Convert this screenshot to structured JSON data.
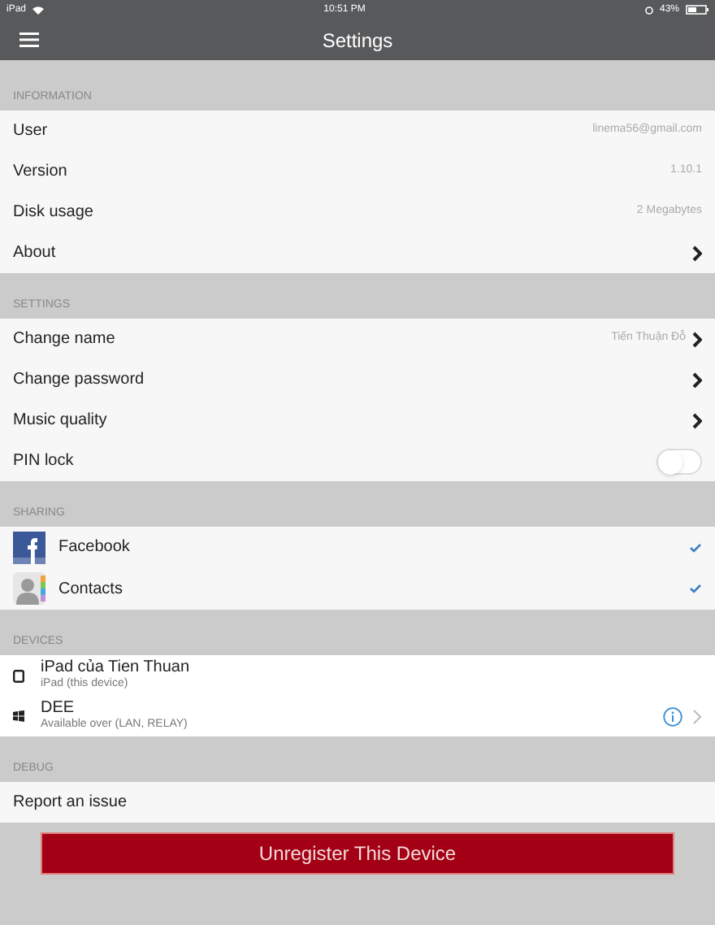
{
  "status_bar": {
    "carrier": "iPad",
    "time": "10:51 PM",
    "battery": "43%"
  },
  "nav": {
    "title": "Settings"
  },
  "sections": [
    {
      "title": "INFORMATION",
      "kind": "rows",
      "rows": [
        {
          "label": "User",
          "value": "linema56@gmail.com",
          "kind": "value"
        },
        {
          "label": "Version",
          "value": "1.10.1",
          "kind": "value"
        },
        {
          "label": "Disk usage",
          "value": "2 Megabytes",
          "kind": "value"
        },
        {
          "label": "About",
          "kind": "link"
        }
      ]
    },
    {
      "title": "SETTINGS",
      "kind": "rows",
      "rows": [
        {
          "label": "Change name",
          "value": "Tiến Thuận Đỗ",
          "kind": "link"
        },
        {
          "label": "Change password",
          "kind": "link"
        },
        {
          "label": "Music quality",
          "kind": "link"
        },
        {
          "label": "PIN lock",
          "kind": "toggle",
          "on": false
        }
      ]
    },
    {
      "title": "SHARING",
      "kind": "sharing",
      "rows": [
        {
          "label": "Facebook",
          "checked": true
        },
        {
          "label": "Contacts",
          "checked": true
        }
      ]
    },
    {
      "title": "DEVICES",
      "kind": "devices",
      "rows": [
        {
          "name": "iPad của Tien Thuan",
          "detail": "iPad (this device)",
          "kind": "local"
        },
        {
          "name": "DEE",
          "detail": "Available over (LAN, RELAY)",
          "kind": "remote"
        }
      ]
    },
    {
      "title": "DEBUG",
      "kind": "rows",
      "rows": [
        {
          "label": "Report an issue",
          "kind": "plain"
        }
      ]
    }
  ],
  "button": {
    "label": "Unregister This Device"
  }
}
